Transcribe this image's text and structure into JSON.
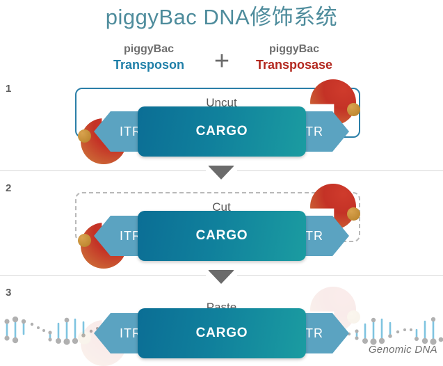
{
  "title": "piggyBac DNA修饰系统",
  "legend": {
    "transposon": {
      "top": "piggyBac",
      "bottom": "Transposon",
      "color": "#1f7fa8"
    },
    "transposase": {
      "top": "piggyBac",
      "bottom": "Transposase",
      "color": "#b3281f"
    },
    "plus": "+"
  },
  "steps": [
    {
      "number": "1",
      "state_label": "Uncut",
      "left_itr": "ITR",
      "cargo": "CARGO",
      "right_itr": "ITR",
      "box_style": "solid",
      "box_color": "#2b7fa8"
    },
    {
      "number": "2",
      "state_label": "Cut",
      "left_itr": "ITR",
      "cargo": "CARGO",
      "right_itr": "ITR",
      "box_style": "dashed",
      "box_color": "#b9b9b9"
    },
    {
      "number": "3",
      "state_label": "Paste",
      "left_itr": "ITR",
      "cargo": "CARGO",
      "right_itr": "ITR",
      "box_style": "none",
      "genomic_dna_label": "Genomic DNA"
    }
  ],
  "colors": {
    "title": "#4e8c9c",
    "itr_fill": "#5ba3c1",
    "cargo_gradient_start": "#0b6e95",
    "cargo_gradient_end": "#1b9ca1",
    "enzyme_red": "#c43226",
    "enzyme_orange": "#cf7f3c",
    "enzyme_ball": "#c08a33",
    "divider": "#d8d8d8",
    "text_gray": "#5a5a5a"
  },
  "icons": {
    "plus": "plus-icon",
    "arrow": "down-triangle-icon",
    "enzyme": "transposase-enzyme-icon",
    "dna": "dna-helix-icon"
  }
}
